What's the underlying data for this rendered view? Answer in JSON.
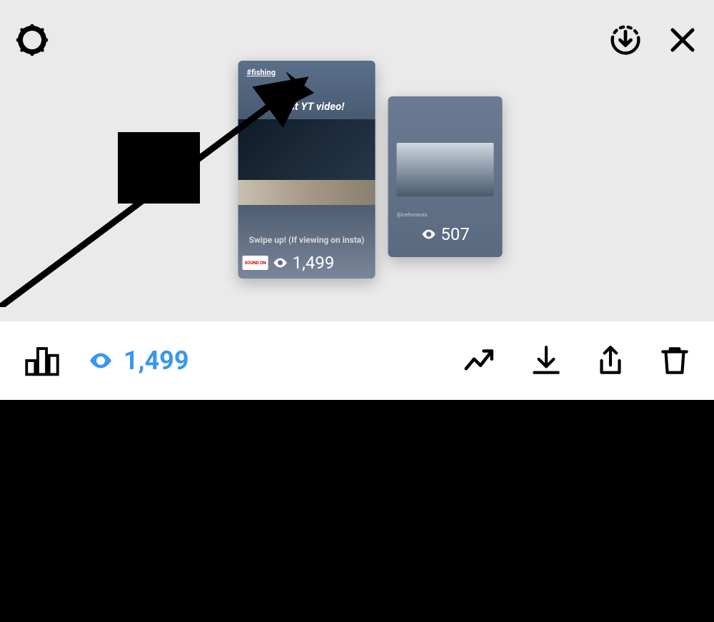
{
  "stories": {
    "primary": {
      "hashtag": "#fishing",
      "title": "Latest YT video!",
      "caption": "Swipe up! (If viewing on insta)",
      "views": "1,499",
      "sound_badge": "SOUND ON"
    },
    "secondary": {
      "tag": "@iceforceusa",
      "views": "507"
    }
  },
  "toolbar": {
    "views": "1,499"
  }
}
